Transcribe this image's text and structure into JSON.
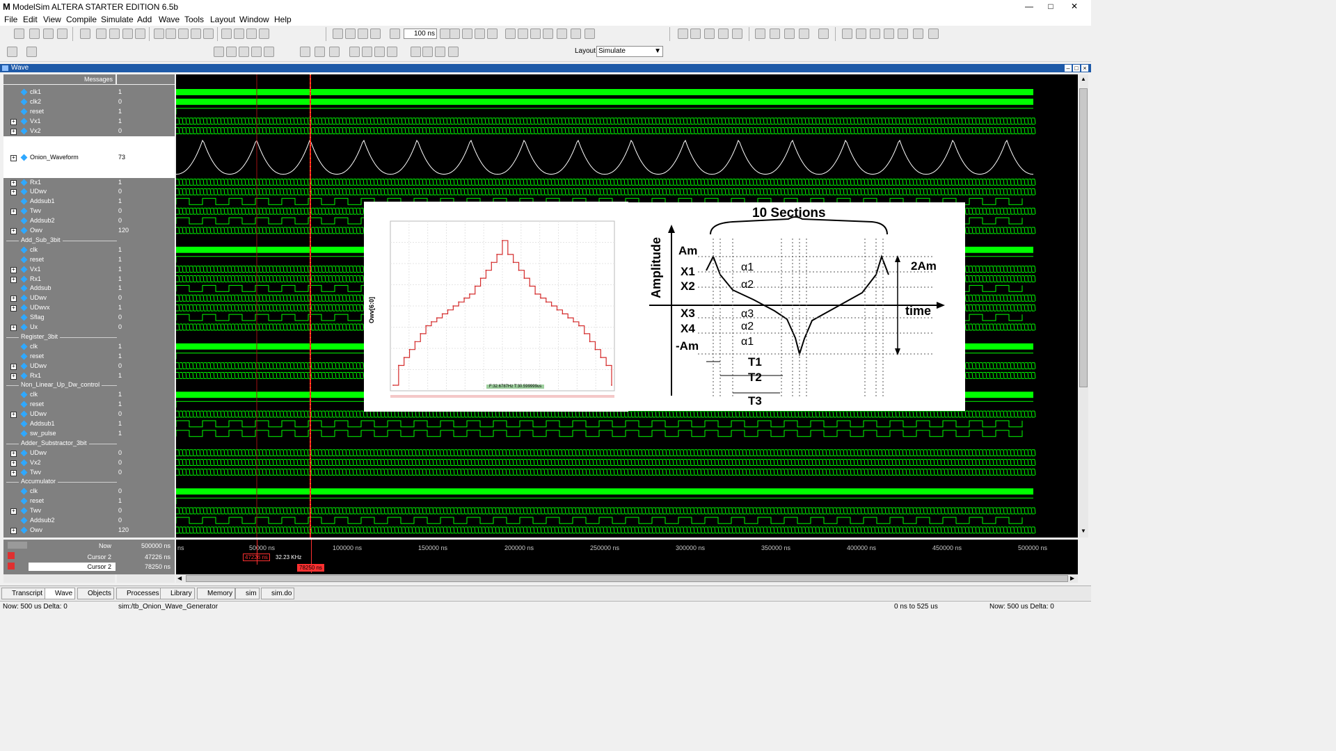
{
  "window": {
    "title": "ModelSim ALTERA STARTER EDITION 6.5b",
    "minimize": "—",
    "maximize": "□",
    "close": "✕"
  },
  "menu": [
    "File",
    "Edit",
    "View",
    "Compile",
    "Simulate",
    "Add",
    "Wave",
    "Tools",
    "Layout",
    "Window",
    "Help"
  ],
  "toolbar": {
    "run_length": "100 ns",
    "layout_label": "Layout",
    "layout_value": "Simulate"
  },
  "wave_panel": {
    "title": "Wave",
    "messages_header": "Messages"
  },
  "signals": [
    {
      "name": "clk1",
      "value": "1",
      "level": 1,
      "expand": false
    },
    {
      "name": "clk2",
      "value": "0",
      "level": 1,
      "expand": false
    },
    {
      "name": "reset",
      "value": "1",
      "level": 1,
      "expand": false
    },
    {
      "name": "Vx1",
      "value": "1",
      "level": 1,
      "expand": true
    },
    {
      "name": "Vx2",
      "value": "0",
      "level": 1,
      "expand": true
    },
    {
      "name": "Onion_Waveform",
      "value": "73",
      "level": 1,
      "expand": true,
      "tall": true
    },
    {
      "name": "Rx1",
      "value": "1",
      "level": 1,
      "expand": true
    },
    {
      "name": "UDwv",
      "value": "0",
      "level": 1,
      "expand": true
    },
    {
      "name": "Addsub1",
      "value": "1",
      "level": 1,
      "expand": false
    },
    {
      "name": "Twv",
      "value": "0",
      "level": 1,
      "expand": true
    },
    {
      "name": "Addsub2",
      "value": "0",
      "level": 1,
      "expand": false
    },
    {
      "name": "Owv",
      "value": "120",
      "level": 1,
      "expand": true
    },
    {
      "name": "Add_Sub_3bit",
      "value": "",
      "level": 0,
      "group": true
    },
    {
      "name": "clk",
      "value": "1",
      "level": 1,
      "expand": false
    },
    {
      "name": "reset",
      "value": "1",
      "level": 1,
      "expand": false
    },
    {
      "name": "Vx1",
      "value": "1",
      "level": 1,
      "expand": true
    },
    {
      "name": "Rx1",
      "value": "1",
      "level": 1,
      "expand": true
    },
    {
      "name": "Addsub",
      "value": "1",
      "level": 1,
      "expand": false
    },
    {
      "name": "UDwv",
      "value": "0",
      "level": 1,
      "expand": true
    },
    {
      "name": "UDwvx",
      "value": "1",
      "level": 1,
      "expand": true
    },
    {
      "name": "Sflag",
      "value": "0",
      "level": 1,
      "expand": false
    },
    {
      "name": "Ux",
      "value": "0",
      "level": 1,
      "expand": true
    },
    {
      "name": "Register_3bit",
      "value": "",
      "level": 0,
      "group": true
    },
    {
      "name": "clk",
      "value": "1",
      "level": 1,
      "expand": false
    },
    {
      "name": "reset",
      "value": "1",
      "level": 1,
      "expand": false
    },
    {
      "name": "UDwv",
      "value": "0",
      "level": 1,
      "expand": true
    },
    {
      "name": "Rx1",
      "value": "1",
      "level": 1,
      "expand": true
    },
    {
      "name": "Non_Linear_Up_Dw_control",
      "value": "",
      "level": 0,
      "group": true
    },
    {
      "name": "clk",
      "value": "1",
      "level": 1,
      "expand": false
    },
    {
      "name": "reset",
      "value": "1",
      "level": 1,
      "expand": false
    },
    {
      "name": "UDwv",
      "value": "0",
      "level": 1,
      "expand": true
    },
    {
      "name": "Addsub1",
      "value": "1",
      "level": 1,
      "expand": false
    },
    {
      "name": "sw_pulse",
      "value": "1",
      "level": 1,
      "expand": false
    },
    {
      "name": "Adder_Substractor_3bit",
      "value": "",
      "level": 0,
      "group": true
    },
    {
      "name": "UDwv",
      "value": "0",
      "level": 1,
      "expand": true
    },
    {
      "name": "Vx2",
      "value": "0",
      "level": 1,
      "expand": true
    },
    {
      "name": "Twv",
      "value": "0",
      "level": 1,
      "expand": true
    },
    {
      "name": "Accumulator",
      "value": "",
      "level": 0,
      "group": true
    },
    {
      "name": "clk",
      "value": "0",
      "level": 1,
      "expand": false
    },
    {
      "name": "reset",
      "value": "1",
      "level": 1,
      "expand": false
    },
    {
      "name": "Twv",
      "value": "0",
      "level": 1,
      "expand": true
    },
    {
      "name": "Addsub2",
      "value": "0",
      "level": 1,
      "expand": false
    },
    {
      "name": "Owv",
      "value": "120",
      "level": 1,
      "expand": true
    }
  ],
  "cursors": {
    "now_label": "Now",
    "now_value": "500000 ns",
    "cursor1_label": "Cursor 2",
    "cursor1_value": "47226 ns",
    "cursor2_label": "Cursor 2",
    "cursor2_value": "78250 ns",
    "cursor1_tag": "47226 ns",
    "cursor2_tag": "78250 ns",
    "freq_tag": "32.23 KHz"
  },
  "time_axis": [
    "ns",
    "50000 ns",
    "100000 ns",
    "150000 ns",
    "200000 ns",
    "250000 ns",
    "300000 ns",
    "350000 ns",
    "400000 ns",
    "450000 ns",
    "500000 ns"
  ],
  "tabs": [
    "Transcript",
    "Wave",
    "Objects",
    "Processes",
    "Library",
    "Memory",
    "sim",
    "sim.do"
  ],
  "status": {
    "now": "Now: 500 us  Delta: 0",
    "path": "sim:/tb_Onion_Wave_Generator",
    "range": "0 ns to 525 us",
    "now2": "Now: 500 us  Delta: 0"
  },
  "inset_chart": {
    "ylabel": "Owv[6:0]",
    "annotation": "F:32.6787Hz T:30.599999us"
  },
  "diagram": {
    "title": "10 Sections",
    "y_axis": "Amplitude",
    "x_axis": "time",
    "levels": [
      "Am",
      "X1",
      "X2",
      "X3",
      "X4",
      "-Am"
    ],
    "slopes": [
      "α1",
      "α2",
      "α3",
      "α2",
      "α1"
    ],
    "span": "2Am",
    "periods": [
      "T1",
      "T2",
      "T3"
    ]
  },
  "colors": {
    "wave_green": "#00ff00",
    "cursor_red": "#ff2020",
    "cursor_yellow": "#ffff00",
    "bg_black": "#000000",
    "panel_gray": "#808080"
  },
  "chart_data": {
    "type": "line",
    "ylabel": "Owv[6:0]",
    "x": [
      0,
      1,
      2,
      3,
      4,
      5,
      6,
      7,
      8,
      9,
      10,
      11,
      12,
      13,
      14,
      15,
      16,
      17,
      18,
      19,
      20,
      21,
      22,
      23,
      24,
      25,
      26,
      27,
      28,
      29,
      30,
      31,
      32,
      33,
      34,
      35,
      36,
      37,
      38,
      39,
      40
    ],
    "series": [
      {
        "values": [
          0,
          10,
          14,
          18,
          22,
          26,
          30,
          32,
          34,
          36,
          38,
          40,
          42,
          44,
          46,
          50,
          54,
          58,
          62,
          66,
          73,
          66,
          62,
          58,
          54,
          50,
          46,
          44,
          42,
          40,
          38,
          36,
          34,
          32,
          30,
          26,
          22,
          18,
          14,
          10,
          0
        ]
      }
    ],
    "ylim": [
      0,
      80
    ]
  }
}
